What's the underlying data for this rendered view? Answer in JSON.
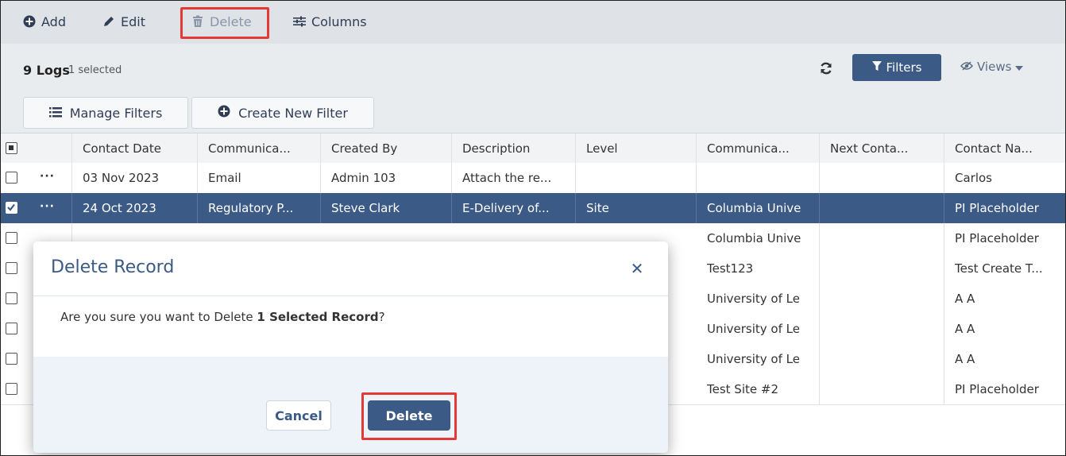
{
  "toolbar": {
    "add_label": "Add",
    "edit_label": "Edit",
    "delete_label": "Delete",
    "columns_label": "Columns"
  },
  "summary": {
    "count_label": "9 Logs",
    "selected_label": "1 selected"
  },
  "actions": {
    "filters_label": "Filters",
    "views_label": "Views",
    "manage_filters_label": "Manage Filters",
    "create_filter_label": "Create New Filter"
  },
  "table": {
    "columns": [
      "Contact Date",
      "Communica...",
      "Created By",
      "Description",
      "Level",
      "Communica...",
      "Next Conta...",
      "Contact Na..."
    ],
    "rows": [
      {
        "contact_date": "03 Nov 2023",
        "communication": "Email",
        "created_by": "Admin 103",
        "description": "Attach the re...",
        "level": "",
        "site": "",
        "next_contact": "",
        "contact_name": "Carlos",
        "checked": false
      },
      {
        "contact_date": "24 Oct 2023",
        "communication": "Regulatory P...",
        "created_by": "Steve Clark",
        "description": "E-Delivery of...",
        "level": "Site",
        "site": "Columbia Unive",
        "next_contact": "",
        "contact_name": "PI Placeholder",
        "checked": true
      },
      {
        "site": "Columbia Unive",
        "contact_name": "PI Placeholder",
        "checked": false
      },
      {
        "site": "Test123",
        "contact_name": "Test Create T...",
        "checked": false
      },
      {
        "site": "University of Le",
        "contact_name": "A A",
        "checked": false
      },
      {
        "site": "University of Le",
        "contact_name": "A A",
        "checked": false
      },
      {
        "site": "University of Le",
        "contact_name": "A A",
        "checked": false
      },
      {
        "site": "Test Site #2",
        "contact_name": "PI Placeholder",
        "checked": false
      }
    ]
  },
  "modal": {
    "title": "Delete Record",
    "message_prefix": "Are you sure you want to Delete ",
    "message_bold": "1 Selected Record",
    "message_suffix": "?",
    "cancel_label": "Cancel",
    "delete_label": "Delete"
  },
  "colors": {
    "primary": "#3c5a86",
    "highlight": "#e53935",
    "toolbar_bg": "#dfe3e8"
  }
}
